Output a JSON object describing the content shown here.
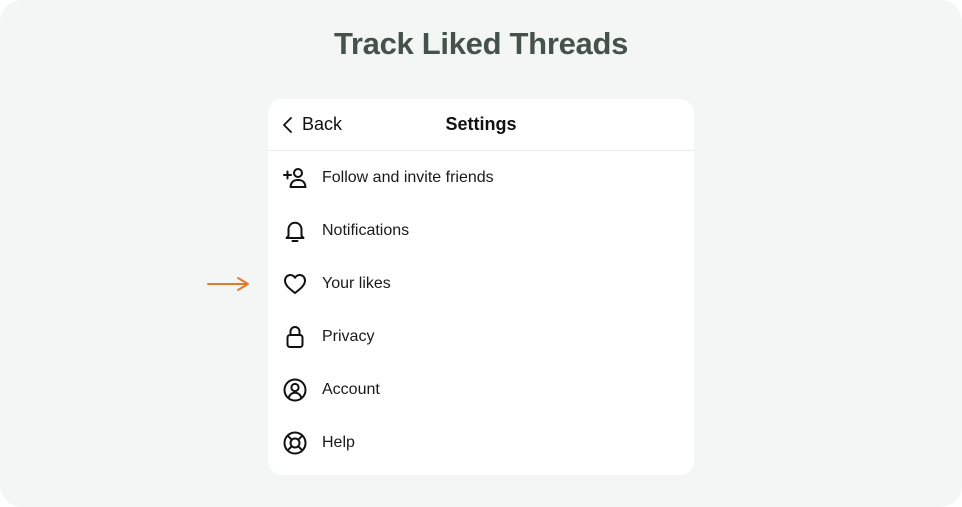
{
  "headline": "Track Liked Threads",
  "header": {
    "back_label": "Back",
    "title": "Settings"
  },
  "menu": {
    "items": [
      {
        "label": "Follow and invite friends",
        "icon": "add-person-icon"
      },
      {
        "label": "Notifications",
        "icon": "bell-icon"
      },
      {
        "label": "Your likes",
        "icon": "heart-icon"
      },
      {
        "label": "Privacy",
        "icon": "lock-icon"
      },
      {
        "label": "Account",
        "icon": "account-circle-icon"
      },
      {
        "label": "Help",
        "icon": "lifebuoy-icon"
      }
    ]
  },
  "colors": {
    "background": "#f4f6f5",
    "headline": "#45524c",
    "card": "#ffffff",
    "pointer_arrow": "#e07b2e"
  }
}
